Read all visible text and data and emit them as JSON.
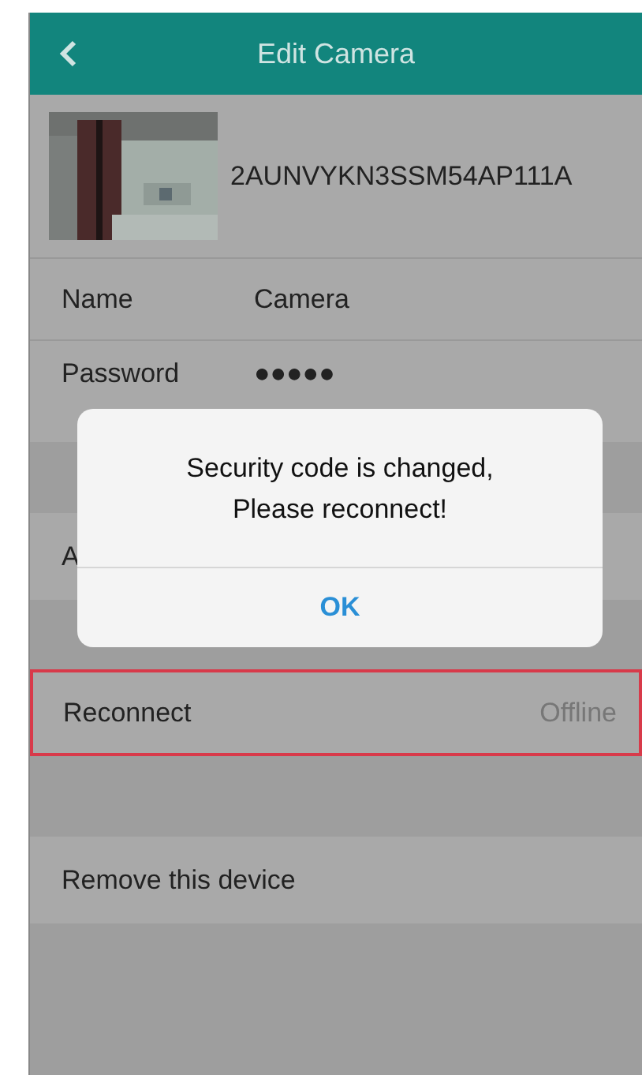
{
  "header": {
    "title": "Edit Camera"
  },
  "camera": {
    "id": "2AUNVYKN3SSM54AP111A"
  },
  "fields": [
    {
      "label": "Name",
      "value": "Camera"
    },
    {
      "label": "Password",
      "value": "●●●●●"
    }
  ],
  "rows": [
    {
      "label": "A",
      "highlighted": false
    },
    {
      "label": "Reconnect",
      "status": "Offline",
      "highlighted": true
    },
    {
      "label": "Remove this device",
      "highlighted": false
    }
  ],
  "alert": {
    "message": "Security code is changed,\nPlease reconnect!",
    "button": "OK"
  }
}
